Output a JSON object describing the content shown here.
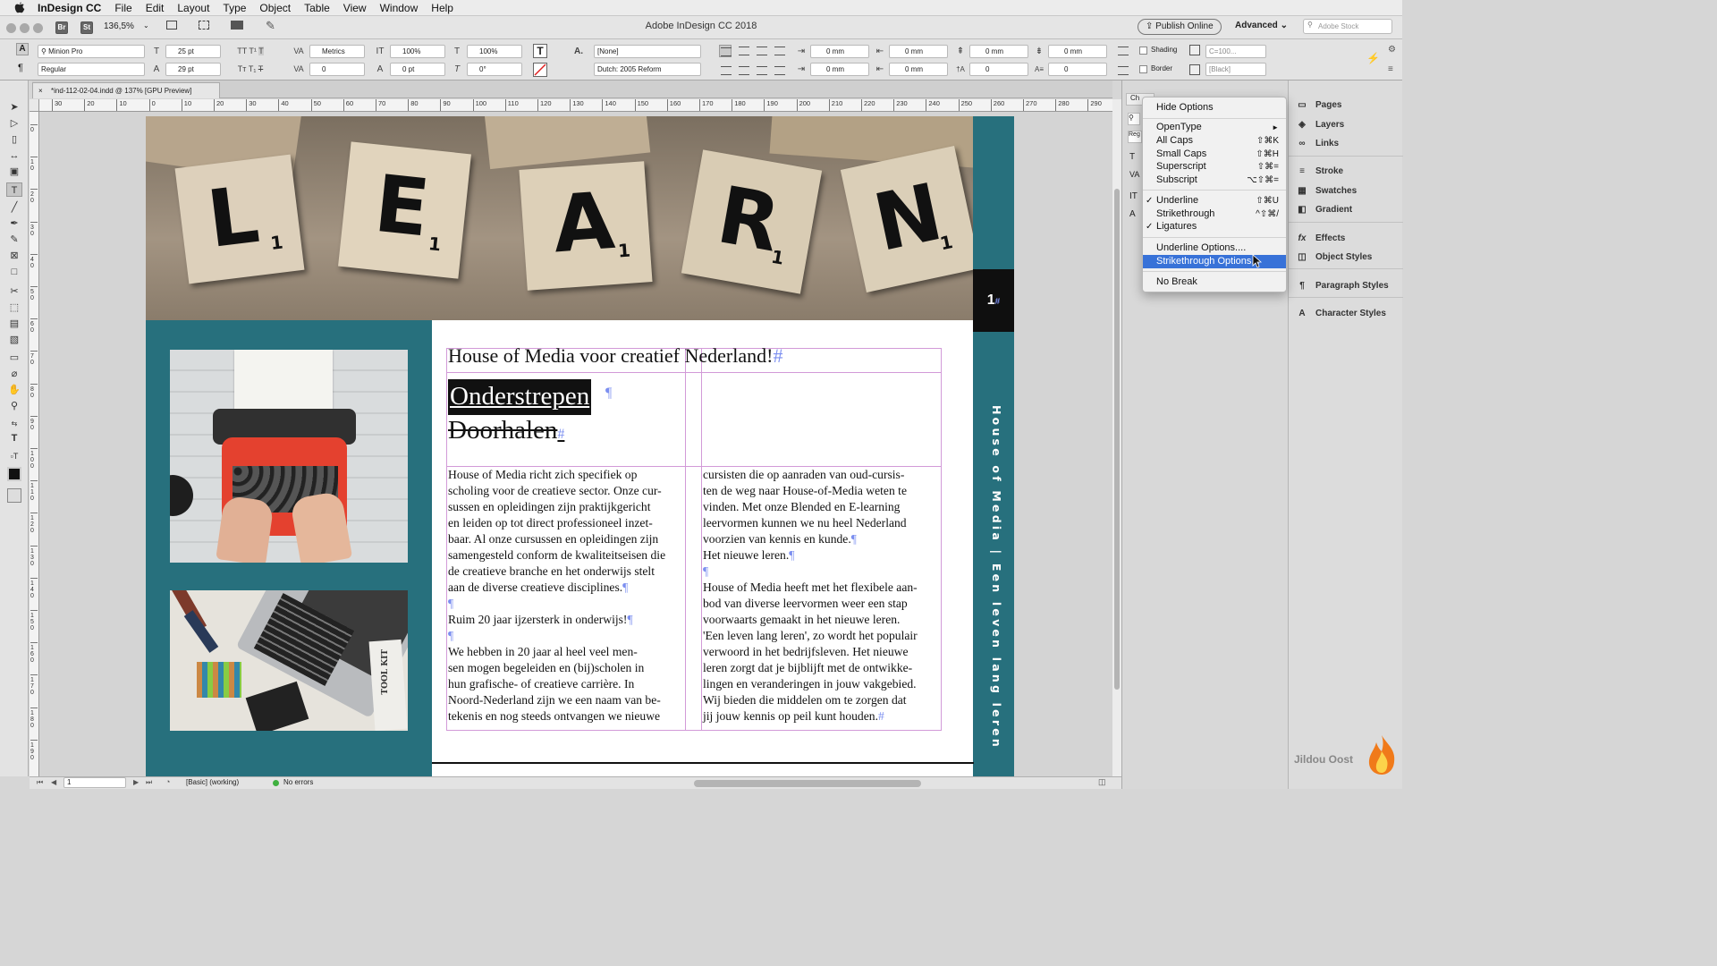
{
  "menubar": {
    "app": "InDesign CC",
    "items": [
      "File",
      "Edit",
      "Layout",
      "Type",
      "Object",
      "Table",
      "View",
      "Window",
      "Help"
    ]
  },
  "appbar": {
    "zoom": "136,5%",
    "title": "Adobe InDesign CC 2018",
    "publish": "Publish Online",
    "workspace": "Advanced",
    "search_placeholder": "Adobe Stock",
    "br": "Br",
    "st": "St"
  },
  "control": {
    "font": "Minion Pro",
    "style": "Regular",
    "size": "25 pt",
    "leading": "29 pt",
    "kerning": "Metrics",
    "tracking": "0",
    "vscale": "100%",
    "hscale": "100%",
    "baseline": "0 pt",
    "skew": "0°",
    "charstyle": "[None]",
    "language": "Dutch: 2005 Reform",
    "indent_left": "0 mm",
    "indent_right": "0 mm",
    "first_line": "0 mm",
    "last_line": "0 mm",
    "space_before": "0 mm",
    "space_after": "0 mm",
    "dropcap_lines": "0",
    "dropcap_chars": "0",
    "shading": "Shading",
    "border": "Border",
    "shading_color": "C=100...",
    "border_color": "[Black]"
  },
  "doctab": "*ind-112-02-04.indd @ 137% [GPU Preview]",
  "hruler": [
    "30",
    "20",
    "10",
    "0",
    "10",
    "20",
    "30",
    "40",
    "50",
    "60",
    "70",
    "80",
    "90",
    "100",
    "110",
    "120",
    "130",
    "140",
    "150",
    "160",
    "170",
    "180",
    "190",
    "200",
    "210",
    "220",
    "230",
    "240",
    "250",
    "260",
    "270",
    "280",
    "290",
    "30"
  ],
  "vruler": [
    "0",
    "1 0",
    "2 0",
    "3 0",
    "4 0",
    "5 0",
    "6 0",
    "7 0",
    "8 0",
    "9 0",
    "1 0 0",
    "1 1 0",
    "1 2 0",
    "1 3 0",
    "1 4 0",
    "1 5 0",
    "1 6 0",
    "1 7 0",
    "1 8 0",
    "1 9 0"
  ],
  "page": {
    "hero_letters": [
      {
        "l": "L",
        "n": "1"
      },
      {
        "l": "E",
        "n": "1"
      },
      {
        "l": "A",
        "n": "1"
      },
      {
        "l": "R",
        "n": "1"
      },
      {
        "l": "N",
        "n": "1"
      }
    ],
    "page_number": "1",
    "heading": "House of Media voor creatief Nederland!",
    "underline": "Onderstrepen",
    "strike": "Doorhalen",
    "vertical": "House of Media | Een leven lang leren",
    "tool_kit": "TOOL KIT",
    "col1": [
      "House of Media richt zich specifiek op",
      "scholing voor de creatieve sector. Onze cur-",
      "sussen en opleidingen zijn praktijkgericht",
      "en leiden op tot direct professioneel inzet-",
      "baar. Al onze cursussen en opleidingen zijn",
      "samengesteld conform de kwaliteitseisen die",
      "de creatieve branche en het onderwijs stelt",
      "aan de diverse creatieve disciplines.",
      "",
      "Ruim 20 jaar ijzersterk in onderwijs!",
      "",
      "We hebben in 20 jaar al heel veel men-",
      "sen mogen begeleiden en (bij)scholen in",
      "hun grafische- of creatieve carrière. In",
      "Noord-Nederland zijn we een naam van be-",
      "tekenis en nog steeds ontvangen we nieuwe"
    ],
    "col2": [
      "cursisten die op aanraden van oud-cursis-",
      "ten de weg naar House-of-Media weten te",
      "vinden. Met onze Blended en E-learning",
      "leervormen kunnen we nu heel Nederland",
      "voorzien van kennis en kunde.",
      "Het nieuwe leren.",
      "",
      "House of Media heeft met het flexibele aan-",
      "bod van diverse leervormen weer een stap",
      "voorwaarts gemaakt in het nieuwe leren.",
      "'Een leven lang leren', zo wordt het populair",
      "verwoord in het bedrijfsleven. Het nieuwe",
      "leren zorgt dat je bijblijft met de ontwikke-",
      "lingen en veranderingen in jouw vakgebied.",
      "Wij bieden die middelen om te zorgen dat",
      "jij jouw kennis op peil kunt houden."
    ]
  },
  "status": {
    "page": "1",
    "style": "[Basic] (working)",
    "errors": "No errors"
  },
  "panel_stub": {
    "tab": "Ch",
    "reg": "Reg"
  },
  "menu": {
    "items": [
      {
        "label": "Hide Options",
        "sc": "",
        "check": ""
      },
      {
        "label": "OpenType",
        "sc": "►",
        "check": ""
      },
      {
        "label": "All Caps",
        "sc": "⇧⌘K",
        "check": ""
      },
      {
        "label": "Small Caps",
        "sc": "⇧⌘H",
        "check": ""
      },
      {
        "label": "Superscript",
        "sc": "⇧⌘=",
        "check": ""
      },
      {
        "label": "Subscript",
        "sc": "⌥⇧⌘=",
        "check": ""
      },
      {
        "label": "Underline",
        "sc": "⇧⌘U",
        "check": "✓"
      },
      {
        "label": "Strikethrough",
        "sc": "^⇧⌘/",
        "check": ""
      },
      {
        "label": "Ligatures",
        "sc": "",
        "check": "✓"
      },
      {
        "label": "Underline Options....",
        "sc": "",
        "check": ""
      },
      {
        "label": "Strikethrough Options...",
        "sc": "",
        "check": ""
      },
      {
        "label": "No Break",
        "sc": "",
        "check": ""
      }
    ]
  },
  "panels": [
    {
      "label": "Pages",
      "icon": "▭"
    },
    {
      "label": "Layers",
      "icon": "◈"
    },
    {
      "label": "Links",
      "icon": "∞"
    },
    {
      "label": "Stroke",
      "icon": "≡"
    },
    {
      "label": "Swatches",
      "icon": "▦"
    },
    {
      "label": "Gradient",
      "icon": "◧"
    },
    {
      "label": "Effects",
      "icon": "fx"
    },
    {
      "label": "Object Styles",
      "icon": "◫"
    },
    {
      "label": "Paragraph Styles",
      "icon": "¶"
    },
    {
      "label": "Character Styles",
      "icon": "A"
    }
  ],
  "watermark": "Jildou Oost",
  "colors": {
    "teal": "#27707d",
    "highlight": "#3872d8"
  }
}
